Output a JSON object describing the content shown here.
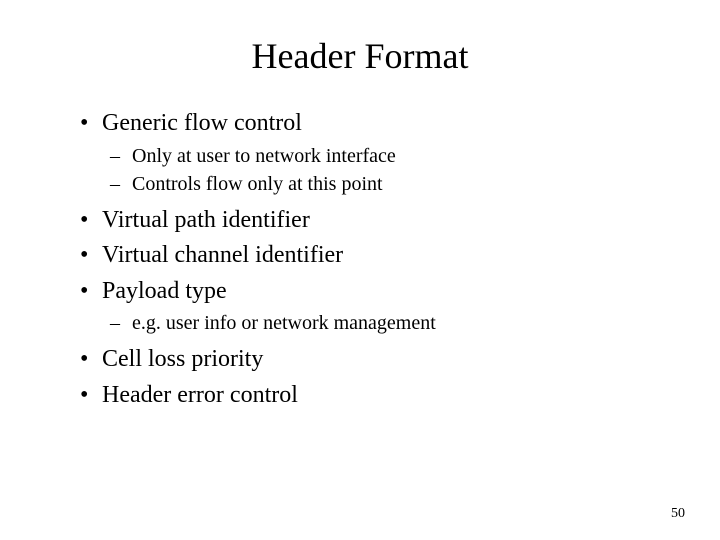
{
  "title": "Header Format",
  "bullets": {
    "b1": "Generic flow control",
    "b1_sub1": "Only at user to network interface",
    "b1_sub2": "Controls flow only at this point",
    "b2": "Virtual path identifier",
    "b3": "Virtual channel identifier",
    "b4": "Payload type",
    "b4_sub1": "e.g. user info or network management",
    "b5": "Cell loss priority",
    "b6": "Header error control"
  },
  "page_number": "50"
}
